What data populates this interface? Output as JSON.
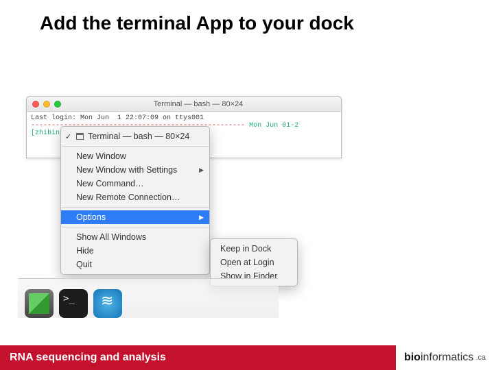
{
  "slide": {
    "title": "Add the terminal App to your dock"
  },
  "terminal": {
    "window_title": "Terminal — bash — 80×24",
    "last_login_line": "Last login: Mon Jun  1 22:07:09 on ttys001",
    "rule_line": "----------------------------------------------------",
    "rule_date": " Mon Jun 01-2",
    "prompt_line": "[zhibin$"
  },
  "context_menu": {
    "header": "Terminal — bash — 80×24",
    "items": [
      {
        "label": "New Window",
        "submenu": false
      },
      {
        "label": "New Window with Settings",
        "submenu": true
      },
      {
        "label": "New Command…",
        "submenu": false
      },
      {
        "label": "New Remote Connection…",
        "submenu": false
      }
    ],
    "options_label": "Options",
    "items2": [
      {
        "label": "Show All Windows"
      },
      {
        "label": "Hide"
      },
      {
        "label": "Quit"
      }
    ]
  },
  "options_submenu": {
    "items": [
      {
        "label": "Keep in Dock"
      },
      {
        "label": "Open at Login"
      },
      {
        "label": "Show in Finder"
      }
    ]
  },
  "dock": {
    "icons": [
      "photos-icon",
      "terminal-icon",
      "openoffice-icon"
    ]
  },
  "footer": {
    "left": "RNA sequencing and analysis",
    "brand_bold": "bio",
    "brand_rest": "informatics",
    "brand_tld": ".ca"
  }
}
